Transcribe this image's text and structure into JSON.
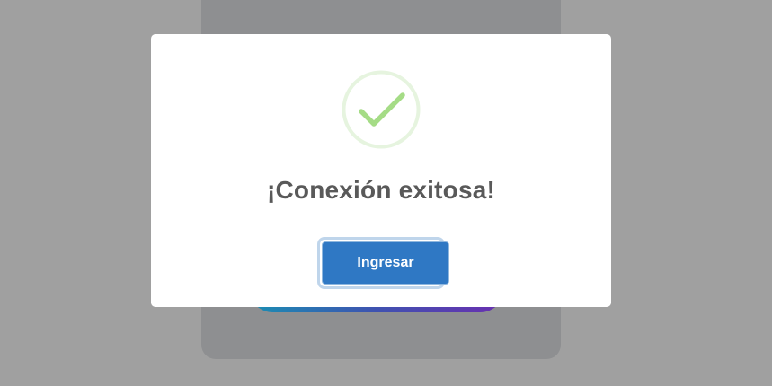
{
  "modal": {
    "title": "¡Conexión exitosa!",
    "icon": "checkmark-success-icon",
    "confirm_label": "Ingresar"
  },
  "colors": {
    "overlay": "#a0a0a0",
    "success_green": "#a5dc86",
    "success_ring": "#e6f4df",
    "button_blue": "#2f78c4",
    "title_text": "#595959",
    "gradient_start": "#1a8fb3",
    "gradient_end": "#6a2fb0"
  }
}
